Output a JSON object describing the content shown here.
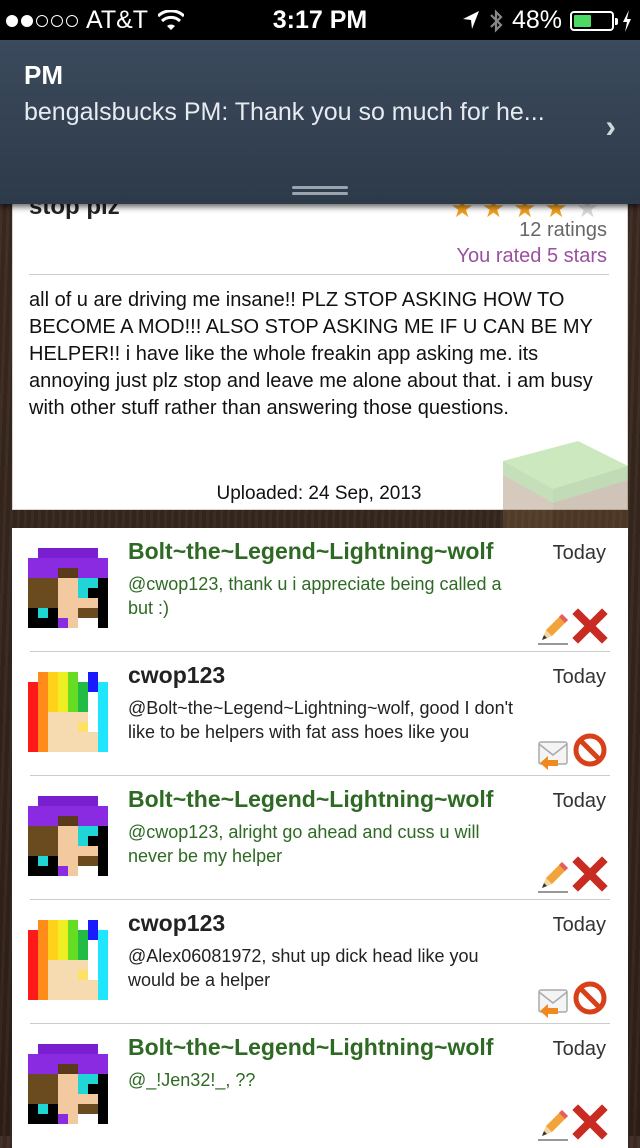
{
  "status_bar": {
    "carrier": "AT&T",
    "time": "3:17 PM",
    "battery": "48%",
    "battery_level": 0.48
  },
  "notification": {
    "title": "PM",
    "message": "bengalsbucks PM: Thank you so much for he...",
    "chevron": "›"
  },
  "post": {
    "title_partial": "stop plz",
    "stars_filled": 4,
    "stars_empty": 1,
    "ratings": "12 ratings",
    "you_rated": "You rated 5 stars",
    "body": "all of u are driving me insane!! PLZ STOP ASKING HOW TO BECOME A MOD!!! ALSO STOP ASKING ME IF U CAN BE MY HELPER!! i have like the whole freakin app asking me. its annoying just plz stop and leave me alone about that. i am busy with other stuff rather than answering those questions.",
    "uploaded": "Uploaded: 24 Sep, 2013"
  },
  "comments": [
    {
      "author": "Bolt~the~Legend~Lightning~wolf",
      "date": "Today",
      "text": "@cwop123, thank u i appreciate being called a but :)",
      "own": true
    },
    {
      "author": "cwop123",
      "date": "Today",
      "text": "@Bolt~the~Legend~Lightning~wolf, good I don't like to be helpers with fat ass hoes like you",
      "own": false
    },
    {
      "author": "Bolt~the~Legend~Lightning~wolf",
      "date": "Today",
      "text": "@cwop123, alright go ahead and cuss u will never be my helper",
      "own": true
    },
    {
      "author": "cwop123",
      "date": "Today",
      "text": "@Alex06081972, shut up dick head like you would be a helper",
      "own": false
    },
    {
      "author": "Bolt~the~Legend~Lightning~wolf",
      "date": "Today",
      "text": "@_!Jen32!_, ??",
      "own": true
    }
  ]
}
